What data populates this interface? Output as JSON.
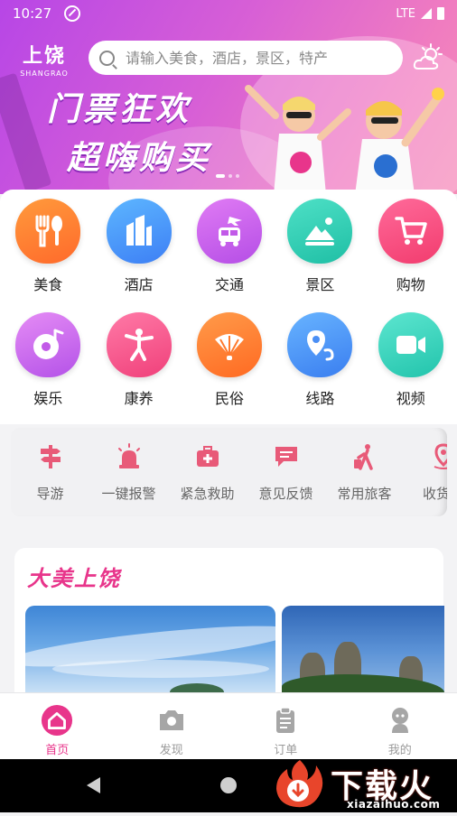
{
  "status_bar": {
    "time": "10:27",
    "network": "LTE"
  },
  "header": {
    "logo_cn": "上饶",
    "logo_en": "SHANGRAO",
    "search_placeholder": "请输入美食，酒店，景区，特产"
  },
  "banner": {
    "line1": "门票狂欢",
    "line2": "超嗨购买",
    "slide_index": 1,
    "slide_count": 3
  },
  "categories": [
    {
      "label": "美食",
      "icon": "fork-knife-icon",
      "color_from": "#ff9a3c",
      "color_to": "#ff6a2b"
    },
    {
      "label": "酒店",
      "icon": "building-icon",
      "color_from": "#5db6ff",
      "color_to": "#3d7ff5"
    },
    {
      "label": "交通",
      "icon": "plane-bus-icon",
      "color_from": "#e07bf4",
      "color_to": "#b54ee6"
    },
    {
      "label": "景区",
      "icon": "mountain-icon",
      "color_from": "#4ee0c6",
      "color_to": "#1fbfa5"
    },
    {
      "label": "购物",
      "icon": "cart-icon",
      "color_from": "#ff6a9a",
      "color_to": "#f23c6e"
    },
    {
      "label": "娱乐",
      "icon": "music-disc-icon",
      "color_from": "#e58cf5",
      "color_to": "#b452e8"
    },
    {
      "label": "康养",
      "icon": "taichi-icon",
      "color_from": "#ff7aa7",
      "color_to": "#f0407a"
    },
    {
      "label": "民俗",
      "icon": "fan-icon",
      "color_from": "#ff9b4a",
      "color_to": "#ff6a22"
    },
    {
      "label": "线路",
      "icon": "route-pin-icon",
      "color_from": "#68b4ff",
      "color_to": "#3a7ef0"
    },
    {
      "label": "视频",
      "icon": "video-camera-icon",
      "color_from": "#5de6d0",
      "color_to": "#22c4ac"
    }
  ],
  "tools": [
    {
      "label": "导游",
      "icon": "signpost-icon"
    },
    {
      "label": "一键报警",
      "icon": "alarm-light-icon"
    },
    {
      "label": "紧急救助",
      "icon": "first-aid-kit-icon"
    },
    {
      "label": "意见反馈",
      "icon": "feedback-icon"
    },
    {
      "label": "常用旅客",
      "icon": "traveler-icon"
    },
    {
      "label": "收货地",
      "icon": "location-pin-icon"
    }
  ],
  "section": {
    "title": "大美上饶"
  },
  "tabbar": [
    {
      "label": "首页",
      "icon": "home-icon",
      "active": true
    },
    {
      "label": "发现",
      "icon": "camera-icon",
      "active": false
    },
    {
      "label": "订单",
      "icon": "clipboard-icon",
      "active": false
    },
    {
      "label": "我的",
      "icon": "user-icon",
      "active": false
    }
  ],
  "watermark": {
    "text": "下载火",
    "url": "xiazaihuo.com"
  },
  "colors": {
    "accent": "#e8358b",
    "tool_icon": "#e85a78"
  }
}
